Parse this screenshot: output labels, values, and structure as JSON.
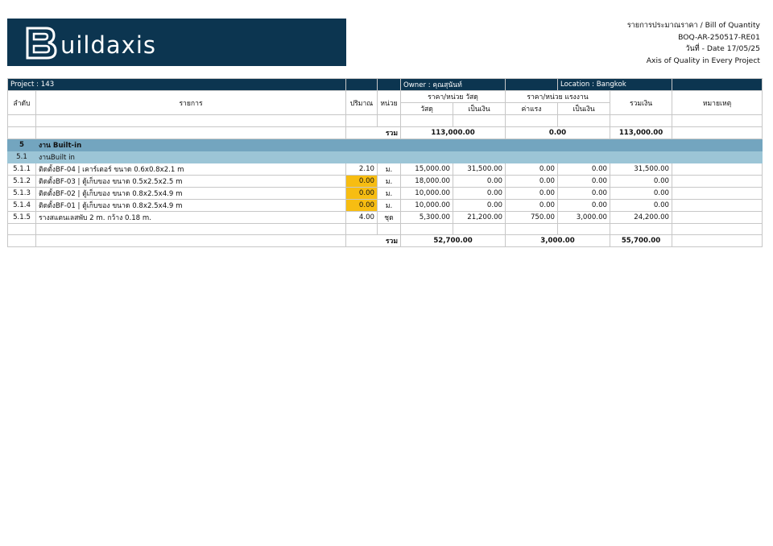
{
  "header": {
    "logo_text": "uildaxis",
    "line1": "รายการประมาณราคา / Bill of Quantity",
    "line2": "BOQ-AR-250517-RE01",
    "line3": "วันที่ - Date 17/05/25",
    "line4": "Axis of Quality in Every Project"
  },
  "info": {
    "project": "Project : 143",
    "owner": "Owner : คุณสุนันท์",
    "location": "Location : Bangkok"
  },
  "columns": {
    "no": "ลำดับ",
    "item": "รายการ",
    "qty": "ปริมาณ",
    "unit": "หน่วย",
    "mat_group": "ราคา/หน่วย วัสดุ",
    "mat_price": "วัสดุ",
    "mat_amount": "เป็นเงิน",
    "lab_group": "ราคา/หน่วย แรงงาน",
    "lab_price": "ค่าแรง",
    "lab_amount": "เป็นเงิน",
    "total": "รวมเงิน",
    "remark": "หมายเหตุ"
  },
  "grand": {
    "label": "รวม",
    "material": "113,000.00",
    "labor": "0.00",
    "total": "113,000.00"
  },
  "section": {
    "no": "5",
    "title": "งาน Built-in"
  },
  "subsection": {
    "no": "5.1",
    "title": "งานBuilt in"
  },
  "rows": [
    {
      "no": "5.1.1",
      "item": "ติดตั้งBF-04 | เคาร์เตอร์ ขนาด 0.6x0.8x2.1 m",
      "qty": "2.10",
      "unit": "ม.",
      "mat_price": "15,000.00",
      "mat_amount": "31,500.00",
      "lab_price": "0.00",
      "lab_amount": "0.00",
      "total": "31,500.00"
    },
    {
      "no": "5.1.2",
      "item": "ติดตั้งBF-03 | ตู้เก็บของ ขนาด 0.5x2.5x2.5 m",
      "qty": "0.00",
      "unit": "ม.",
      "mat_price": "18,000.00",
      "mat_amount": "0.00",
      "lab_price": "0.00",
      "lab_amount": "0.00",
      "total": "0.00"
    },
    {
      "no": "5.1.3",
      "item": "ติดตั้งBF-02 | ตู้เก็บของ ขนาด 0.8x2.5x4.9 m",
      "qty": "0.00",
      "unit": "ม.",
      "mat_price": "10,000.00",
      "mat_amount": "0.00",
      "lab_price": "0.00",
      "lab_amount": "0.00",
      "total": "0.00"
    },
    {
      "no": "5.1.4",
      "item": "ติดตั้งBF-01 | ตู้เก็บของ ขนาด 0.8x2.5x4.9 m",
      "qty": "0.00",
      "unit": "ม.",
      "mat_price": "10,000.00",
      "mat_amount": "0.00",
      "lab_price": "0.00",
      "lab_amount": "0.00",
      "total": "0.00"
    },
    {
      "no": "5.1.5",
      "item": "รางสแตนเลสพับ 2 m. กว้าง 0.18 m.",
      "qty": "4.00",
      "unit": "ชุด",
      "mat_price": "5,300.00",
      "mat_amount": "21,200.00",
      "lab_price": "750.00",
      "lab_amount": "3,000.00",
      "total": "24,200.00"
    }
  ],
  "subtotal": {
    "label": "รวม",
    "material": "52,700.00",
    "labor": "3,000.00",
    "total": "55,700.00"
  },
  "colors": {
    "navy": "#0c3550",
    "section": "#73a5bf",
    "subsection": "#9cc5d6",
    "highlight": "#f7bd12"
  }
}
